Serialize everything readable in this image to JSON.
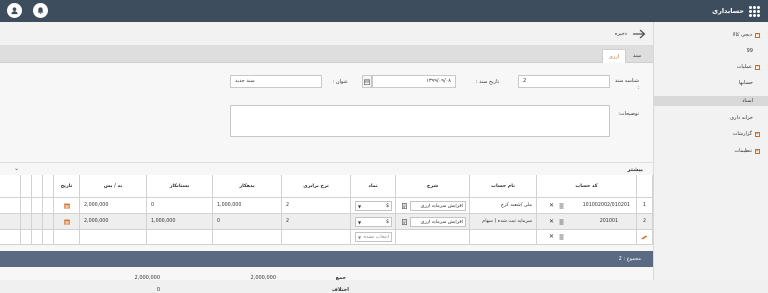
{
  "app": {
    "title": "حسابداری"
  },
  "sidebar": {
    "items": [
      {
        "label": "دیجی کالا",
        "toggle": "-"
      },
      {
        "label": "99",
        "toggle": ""
      },
      {
        "label": "عملیات",
        "toggle": "-"
      },
      {
        "label": "حسابها",
        "toggle": ""
      },
      {
        "label": "اسناد",
        "toggle": ""
      },
      {
        "label": "خزانه داری",
        "toggle": ""
      },
      {
        "label": "گزارشات",
        "toggle": "+"
      },
      {
        "label": "تنظیمات",
        "toggle": "+"
      }
    ]
  },
  "toolbar": {
    "save_label": "ذخیره"
  },
  "tabs": [
    {
      "label": "سند"
    },
    {
      "label": "ارزی"
    }
  ],
  "form": {
    "doc_number_label": "شناسه سند :",
    "doc_number_value": "2",
    "doc_date_label": "تاریخ سند :",
    "doc_date_value": "۱۳۹۹/۰۹/۰۸",
    "title_label": "عنوان :",
    "title_value": "سند جدید",
    "desc_label": "توضیحات:"
  },
  "more_label": "بیشتر",
  "table": {
    "headers": [
      "کد حساب",
      "نام حساب",
      "شرح",
      "نماد",
      "نرخ برابری",
      "بدهکار",
      "بستانکار",
      "بد / بس",
      "تاریخ"
    ],
    "rows": [
      {
        "num": "1",
        "code": "101002002/010201",
        "name": "ملی /شعبه کرج",
        "desc": "افزایش سرمایه ارزی",
        "symbol": "$",
        "rate": "2",
        "debit": "1,000,000",
        "credit": "0",
        "balance": "2,000,000"
      },
      {
        "num": "2",
        "code": "201001",
        "name": "سرمایه ثبت شده ( سهام",
        "desc": "افزایش سرمایه ارزی",
        "symbol": "$",
        "rate": "2",
        "debit": "0",
        "credit": "1,000,000",
        "balance": "2,000,000"
      }
    ],
    "new_row": {
      "symbol_placeholder": "انتخاب نشده"
    }
  },
  "summary": {
    "total_label": "مجموع : 2",
    "sum_label": "جمع",
    "diff_label": "اختلاف",
    "sum_debit": "2,000,000",
    "sum_credit": "2,000,000",
    "diff_value": "0"
  },
  "colors": {
    "topbar": "#3d4d5e",
    "accent": "#d26a1f",
    "summary_bar": "#5a6a82"
  }
}
